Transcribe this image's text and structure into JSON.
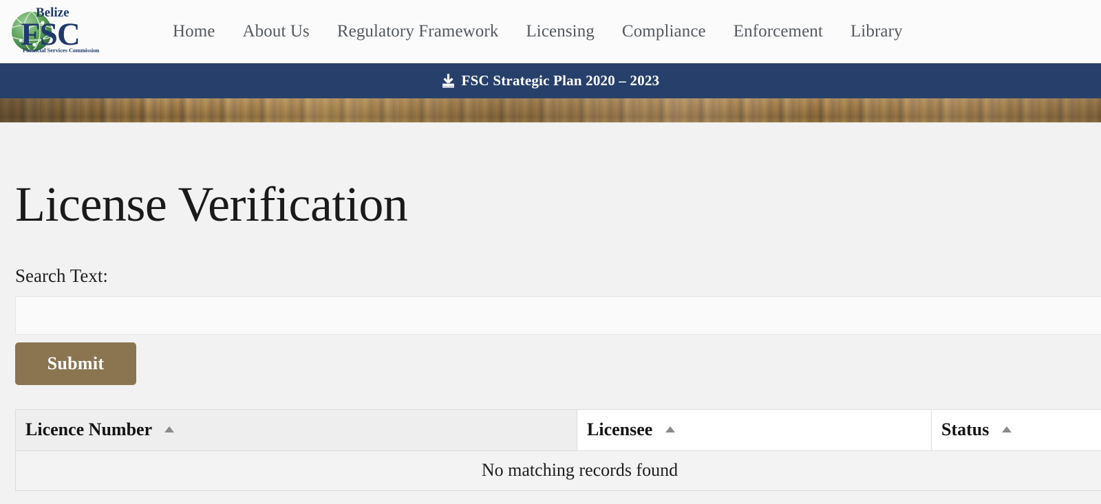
{
  "site": {
    "logo": {
      "brand_top": "Belize",
      "brand_main": "FSC",
      "brand_sub": "Financial Services Commission",
      "globe_color": "#4e9153",
      "text_color": "#203a6b"
    },
    "nav": {
      "items": [
        {
          "label": "Home",
          "name": "nav-item-home"
        },
        {
          "label": "About Us",
          "name": "nav-item-about-us"
        },
        {
          "label": "Regulatory Framework",
          "name": "nav-item-regulatory-framework"
        },
        {
          "label": "Licensing",
          "name": "nav-item-licensing"
        },
        {
          "label": "Compliance",
          "name": "nav-item-compliance"
        },
        {
          "label": "Enforcement",
          "name": "nav-item-enforcement"
        },
        {
          "label": "Library",
          "name": "nav-item-library"
        }
      ]
    }
  },
  "announcement": {
    "icon": "download-icon",
    "text": "FSC Strategic Plan 2020 – 2023",
    "background_color": "#27406b",
    "text_color": "#ffffff"
  },
  "main": {
    "page_title": "License Verification",
    "search": {
      "label": "Search Text:",
      "value": "",
      "placeholder": ""
    },
    "submit_button": {
      "label": "Submit",
      "color": "#8a7550"
    },
    "table": {
      "columns": [
        {
          "label": "Licence Number",
          "sort": "asc"
        },
        {
          "label": "Licensee",
          "sort": "asc"
        },
        {
          "label": "Status",
          "sort": "asc"
        }
      ],
      "rows": [],
      "empty_message": "No matching records found"
    }
  },
  "theme": {
    "page_background": "#f2f2f2",
    "header_background": "#fbfbfb",
    "navy": "#27406b",
    "accent_brown": "#8a7550",
    "nav_text": "#54595f"
  }
}
